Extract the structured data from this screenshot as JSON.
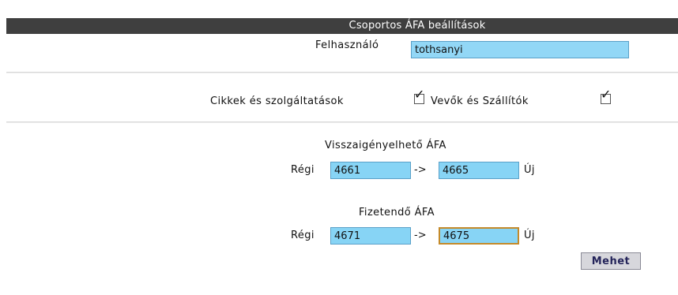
{
  "header": {
    "title": "Csoportos ÁFA beállítások"
  },
  "user": {
    "label": "Felhasználó",
    "value": "tothsanyi"
  },
  "options": {
    "items_label": "Cikkek és szolgáltatások",
    "items_checked": true,
    "partners_label": "Vevők és Szállítók",
    "partners_checked": true
  },
  "reclaimable": {
    "title": "Visszaigényelhető ÁFA",
    "old_label": "Régi",
    "old_value": "4661",
    "arrow": "->",
    "new_value": "4665",
    "new_label": "Új"
  },
  "payable": {
    "title": "Fizetendő ÁFA",
    "old_label": "Régi",
    "old_value": "4671",
    "arrow": "->",
    "new_value": "4675",
    "new_label": "Új"
  },
  "submit": {
    "label": "Mehet"
  }
}
